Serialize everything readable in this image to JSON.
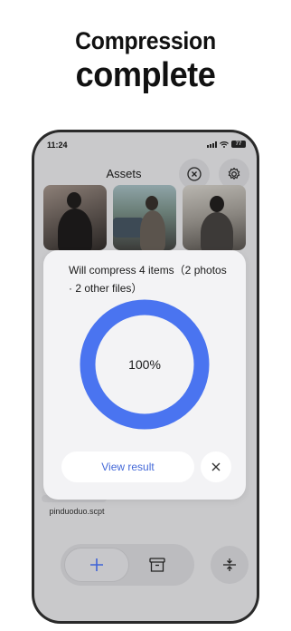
{
  "headline": {
    "line1": "Compression",
    "line2": "complete"
  },
  "status_bar": {
    "time": "11:24",
    "battery": "77"
  },
  "header": {
    "title": "Assets",
    "close_icon": "close-icon",
    "settings_icon": "gear-icon"
  },
  "thumbnails": [
    {
      "name": "photo-woman-black-outfit"
    },
    {
      "name": "photo-street-car"
    },
    {
      "name": "photo-mirror-selfie"
    }
  ],
  "file_item": {
    "label": "pinduoduo.scpt"
  },
  "dialog": {
    "message": "Will compress 4 items（2 photos · 2 other files）",
    "progress_text": "100%",
    "progress_fraction": 1.0,
    "view_result_label": "View result",
    "accent_color": "#4a74f0"
  },
  "bottom_bar": {
    "add_icon": "plus-icon",
    "archive_icon": "archive-box-icon",
    "compress_icon": "compress-icon"
  }
}
